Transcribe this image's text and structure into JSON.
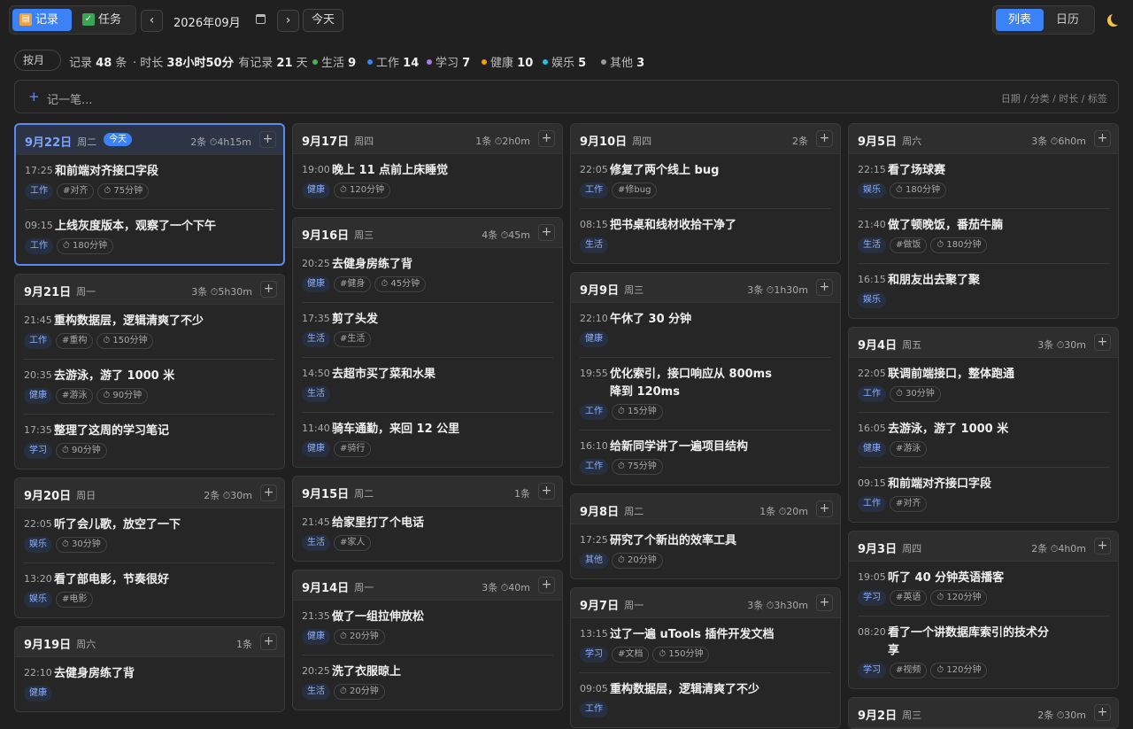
{
  "toolbar": {
    "tab_records": "记录",
    "tab_tasks": "任务",
    "prev": "‹",
    "next": "›",
    "month": "2026年09月",
    "today": "今天",
    "view_list": "列表",
    "view_calendar": "日历"
  },
  "stats": {
    "by": "按月",
    "records_label": "记录",
    "records": "48",
    "records_unit": "条",
    "duration_label": "时长",
    "duration": "38小时50分",
    "days_label": "有记录",
    "days": "21",
    "days_unit": "天",
    "categories": [
      {
        "name": "生活",
        "count": "9",
        "color": "#4caf50"
      },
      {
        "name": "工作",
        "count": "14",
        "color": "#3b82f6"
      },
      {
        "name": "学习",
        "count": "7",
        "color": "#a87ce8"
      },
      {
        "name": "健康",
        "count": "10",
        "color": "#f59e0b"
      },
      {
        "name": "娱乐",
        "count": "5",
        "color": "#22c3d6"
      },
      {
        "name": "其他",
        "count": "3",
        "color": "#9a9a9a"
      }
    ]
  },
  "quick": {
    "placeholder": "记一笔...",
    "hint": "日期 / 分类 / 时长 / 标签"
  },
  "columns": [
    [
      {
        "date": "9月22日",
        "weekday": "周二",
        "today": "今天",
        "count": "2条",
        "dur": "⏱4h15m",
        "entries": [
          {
            "time": "17:25",
            "text": "和前端对齐接口字段",
            "cat": "工作",
            "tag": "#对齐",
            "dur": "⏱ 75分钟"
          },
          {
            "time": "09:15",
            "text": "上线灰度版本，观察了一个下午",
            "cat": "工作",
            "tag": "",
            "dur": "⏱ 180分钟"
          }
        ]
      },
      {
        "date": "9月21日",
        "weekday": "周一",
        "count": "3条",
        "dur": "⏱5h30m",
        "entries": [
          {
            "time": "21:45",
            "text": "重构数据层，逻辑清爽了不少",
            "cat": "工作",
            "tag": "#重构",
            "dur": "⏱ 150分钟"
          },
          {
            "time": "20:35",
            "text": "去游泳，游了 1000 米",
            "cat": "健康",
            "tag": "#游泳",
            "dur": "⏱ 90分钟"
          },
          {
            "time": "17:35",
            "text": "整理了这周的学习笔记",
            "cat": "学习",
            "tag": "",
            "dur": "⏱ 90分钟"
          }
        ]
      },
      {
        "date": "9月20日",
        "weekday": "周日",
        "count": "2条",
        "dur": "⏱30m",
        "entries": [
          {
            "time": "22:05",
            "text": "听了会儿歌，放空了一下",
            "cat": "娱乐",
            "tag": "",
            "dur": "⏱ 30分钟"
          },
          {
            "time": "13:20",
            "text": "看了部电影，节奏很好",
            "cat": "娱乐",
            "tag": "#电影",
            "dur": ""
          }
        ]
      },
      {
        "date": "9月19日",
        "weekday": "周六",
        "count": "1条",
        "dur": "",
        "entries": [
          {
            "time": "22:10",
            "text": "去健身房练了背",
            "cat": "健康",
            "tag": "",
            "dur": ""
          }
        ]
      }
    ],
    [
      {
        "date": "9月17日",
        "weekday": "周四",
        "count": "1条",
        "dur": "⏱2h0m",
        "entries": [
          {
            "time": "19:00",
            "text": "晚上 11 点前上床睡觉",
            "cat": "健康",
            "tag": "",
            "dur": "⏱ 120分钟"
          }
        ]
      },
      {
        "date": "9月16日",
        "weekday": "周三",
        "count": "4条",
        "dur": "⏱45m",
        "entries": [
          {
            "time": "20:25",
            "text": "去健身房练了背",
            "cat": "健康",
            "tag": "#健身",
            "dur": "⏱ 45分钟"
          },
          {
            "time": "17:35",
            "text": "剪了头发",
            "cat": "生活",
            "tag": "#生活",
            "dur": ""
          },
          {
            "time": "14:50",
            "text": "去超市买了菜和水果",
            "cat": "生活",
            "tag": "",
            "dur": ""
          },
          {
            "time": "11:40",
            "text": "骑车通勤，来回 12 公里",
            "cat": "健康",
            "tag": "#骑行",
            "dur": ""
          }
        ]
      },
      {
        "date": "9月15日",
        "weekday": "周二",
        "count": "1条",
        "dur": "",
        "entries": [
          {
            "time": "21:45",
            "text": "给家里打了个电话",
            "cat": "生活",
            "tag": "#家人",
            "dur": ""
          }
        ]
      },
      {
        "date": "9月14日",
        "weekday": "周一",
        "count": "3条",
        "dur": "⏱40m",
        "entries": [
          {
            "time": "21:35",
            "text": "做了一组拉伸放松",
            "cat": "健康",
            "tag": "",
            "dur": "⏱ 20分钟"
          },
          {
            "time": "20:25",
            "text": "洗了衣服晾上",
            "cat": "生活",
            "tag": "",
            "dur": "⏱ 20分钟"
          }
        ]
      }
    ],
    [
      {
        "date": "9月10日",
        "weekday": "周四",
        "count": "2条",
        "dur": "",
        "entries": [
          {
            "time": "22:05",
            "text": "修复了两个线上 bug",
            "cat": "工作",
            "tag": "#修bug",
            "dur": ""
          },
          {
            "time": "08:15",
            "text": "把书桌和线材收拾干净了",
            "cat": "生活",
            "tag": "",
            "dur": ""
          }
        ]
      },
      {
        "date": "9月9日",
        "weekday": "周三",
        "count": "3条",
        "dur": "⏱1h30m",
        "entries": [
          {
            "time": "22:10",
            "text": "午休了 30 分钟",
            "cat": "健康",
            "tag": "",
            "dur": ""
          },
          {
            "time": "19:55",
            "text": "优化索引，接口响应从 800ms 降到 120ms",
            "cat": "工作",
            "tag": "",
            "dur": "⏱ 15分钟"
          },
          {
            "time": "16:10",
            "text": "给新同学讲了一遍项目结构",
            "cat": "工作",
            "tag": "",
            "dur": "⏱ 75分钟"
          }
        ]
      },
      {
        "date": "9月8日",
        "weekday": "周二",
        "count": "1条",
        "dur": "⏱20m",
        "entries": [
          {
            "time": "17:25",
            "text": "研究了个新出的效率工具",
            "cat": "其他",
            "tag": "",
            "dur": "⏱ 20分钟"
          }
        ]
      },
      {
        "date": "9月7日",
        "weekday": "周一",
        "count": "3条",
        "dur": "⏱3h30m",
        "entries": [
          {
            "time": "13:15",
            "text": "过了一遍 uTools 插件开发文档",
            "cat": "学习",
            "tag": "#文档",
            "dur": "⏱ 150分钟"
          },
          {
            "time": "09:05",
            "text": "重构数据层，逻辑清爽了不少",
            "cat": "工作",
            "tag": "",
            "dur": ""
          }
        ]
      }
    ],
    [
      {
        "date": "9月5日",
        "weekday": "周六",
        "count": "3条",
        "dur": "⏱6h0m",
        "entries": [
          {
            "time": "22:15",
            "text": "看了场球赛",
            "cat": "娱乐",
            "tag": "",
            "dur": "⏱ 180分钟"
          },
          {
            "time": "21:40",
            "text": "做了顿晚饭，番茄牛腩",
            "cat": "生活",
            "tag": "#做饭",
            "dur": "⏱ 180分钟"
          },
          {
            "time": "16:15",
            "text": "和朋友出去聚了聚",
            "cat": "娱乐",
            "tag": "",
            "dur": ""
          }
        ]
      },
      {
        "date": "9月4日",
        "weekday": "周五",
        "count": "3条",
        "dur": "⏱30m",
        "entries": [
          {
            "time": "22:05",
            "text": "联调前端接口，整体跑通",
            "cat": "工作",
            "tag": "",
            "dur": "⏱ 30分钟"
          },
          {
            "time": "16:05",
            "text": "去游泳，游了 1000 米",
            "cat": "健康",
            "tag": "#游泳",
            "dur": ""
          },
          {
            "time": "09:15",
            "text": "和前端对齐接口字段",
            "cat": "工作",
            "tag": "#对齐",
            "dur": ""
          }
        ]
      },
      {
        "date": "9月3日",
        "weekday": "周四",
        "count": "2条",
        "dur": "⏱4h0m",
        "entries": [
          {
            "time": "19:05",
            "text": "听了 40 分钟英语播客",
            "cat": "学习",
            "tag": "#英语",
            "dur": "⏱ 120分钟"
          },
          {
            "time": "08:20",
            "text": "看了一个讲数据库索引的技术分享",
            "cat": "学习",
            "tag": "#视频",
            "dur": "⏱ 120分钟"
          }
        ]
      },
      {
        "date": "9月2日",
        "weekday": "周三",
        "count": "2条",
        "dur": "⏱30m",
        "entries": []
      }
    ]
  ]
}
